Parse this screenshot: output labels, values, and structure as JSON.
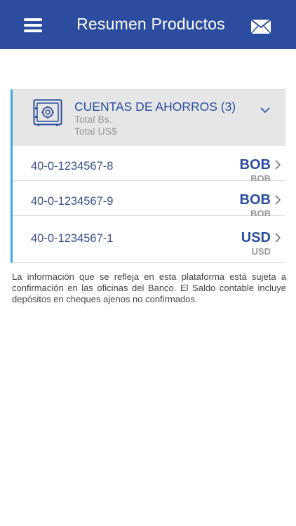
{
  "header": {
    "title": "Resumen Productos",
    "background_color": "#2c4d9f",
    "menu_icon": "hamburger-menu-icon",
    "mail_icon": "envelope-icon"
  },
  "card": {
    "accent_color": "#3aa8e6",
    "icon": "safe-icon",
    "title": "CUENTAS DE AHORROS (3)",
    "total_bs_label": "Total Bs.",
    "total_usd_label": "Total US$",
    "expand_icon": "chevron-down-icon",
    "accounts": [
      {
        "number": "40-0-1234567-8",
        "currency": "BOB",
        "currency_sub": "BOB"
      },
      {
        "number": "40-0-1234567-9",
        "currency": "BOB",
        "currency_sub": "BOB"
      },
      {
        "number": "40-0-1234567-1",
        "currency": "USD",
        "currency_sub": "USD"
      }
    ]
  },
  "disclaimer": "La información que se refleja en esta plataforma está sujeta a confirmación en las oficinas del Banco. El Saldo contable incluye depósitos en cheques ajenos no confirmados."
}
